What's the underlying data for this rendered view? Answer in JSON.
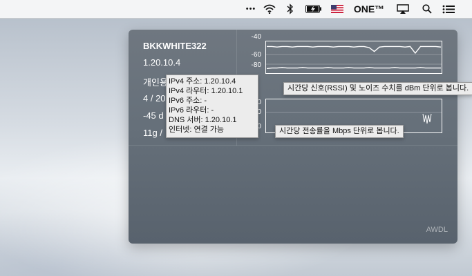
{
  "menubar": {
    "more": "•••",
    "wifi_icon": "wifi-icon",
    "bluetooth_icon": "bluetooth-icon",
    "battery_icon": "battery-charging-icon",
    "flag_icon": "us-flag-icon",
    "app_label": "ONE™",
    "airplay_icon": "airplay-icon",
    "search_icon": "search-icon",
    "list_icon": "list-icon"
  },
  "panel": {
    "ssid": "BKKWHITE322",
    "ip": "1.20.10.4",
    "row3": "개인용",
    "row4": "4 / 20",
    "row5": "-45 d",
    "row6": "11g / ",
    "awdl": "AWDL"
  },
  "signal_chart": {
    "y_labels": [
      "-40",
      "-60",
      "-80"
    ]
  },
  "rate_chart": {
    "y_labels": [
      "0",
      "0",
      "0"
    ]
  },
  "network_tooltip": {
    "lines": [
      "IPv4 주소: 1.20.10.4",
      "IPv4 라우터: 1.20.10.1",
      "IPv6 주소: -",
      "IPv6 라우터: -",
      "DNS 서버: 1.20.10.1",
      "인터넷: 연결 가능"
    ]
  },
  "rssi_tooltip": "시간당 신호(RSSI) 및 노이즈 수치를 dBm 단위로 봅니다.",
  "rate_tooltip": "시간당 전송률을 Mbps 단위로 봅니다.",
  "chart_data": {
    "type": "line",
    "yticks": [
      -40,
      -60,
      -80
    ],
    "series_signal_dbm": [
      -43,
      -43,
      -44,
      -43,
      -43,
      -44,
      -43,
      -43,
      -43,
      -44,
      -43,
      -43,
      -43,
      -44,
      -43,
      -43,
      -43,
      -44,
      -43,
      -43,
      -45,
      -52,
      -44,
      -43,
      -43,
      -43,
      -43,
      -44,
      -43,
      -55,
      -43,
      -43,
      -43,
      -43,
      -44
    ],
    "series_noise_dbm": [
      -83,
      -82,
      -82,
      -81,
      -82,
      -82,
      -82,
      -81,
      -82,
      -82,
      -82,
      -82,
      -81,
      -82,
      -82,
      -82,
      -81,
      -82,
      -82,
      -82,
      -81,
      -82,
      -82,
      -82,
      -82,
      -81,
      -82,
      -82,
      -82,
      -82,
      -81,
      -82,
      -82,
      -82,
      -82
    ]
  }
}
